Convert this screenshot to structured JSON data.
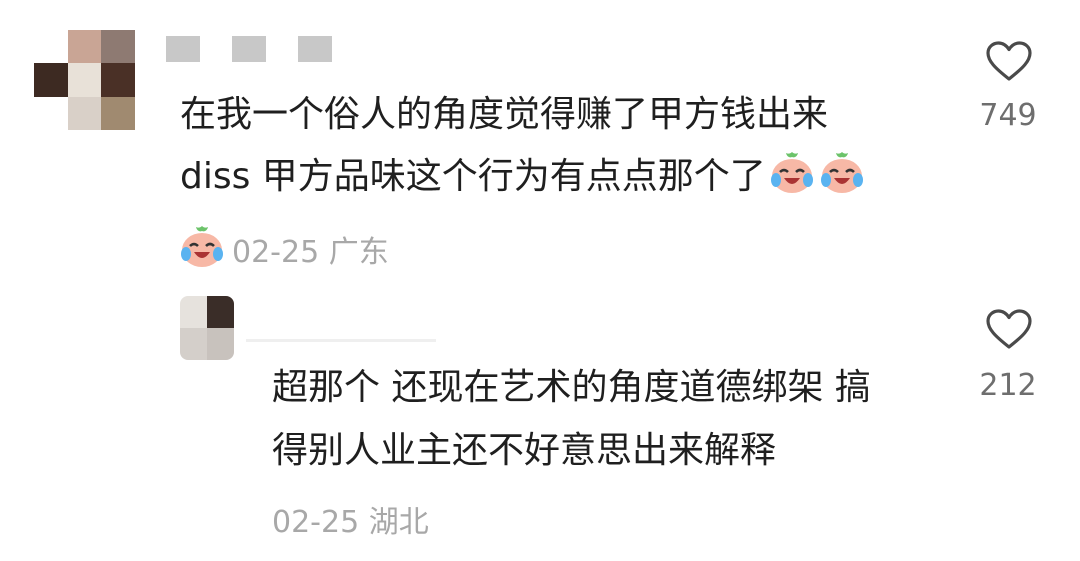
{
  "colors": {
    "text": "#1f1f1f",
    "meta": "#a8a8a8",
    "like_count": "#6e6e6e",
    "heart_stroke": "#4a4a4a"
  },
  "comments": [
    {
      "line1": "在我一个俗人的角度觉得赚了甲方钱出来",
      "line2": "diss 甲方品味这个行为有点点那个了",
      "emoji": "laughing-crying-emoji",
      "date": "02-25",
      "location": "广东",
      "likes": "749"
    },
    {
      "line1": "超那个 还现在艺术的角度道德绑架 搞",
      "line2": "得别人业主还不好意思出来解释",
      "date": "02-25",
      "location": "湖北",
      "likes": "212"
    }
  ]
}
